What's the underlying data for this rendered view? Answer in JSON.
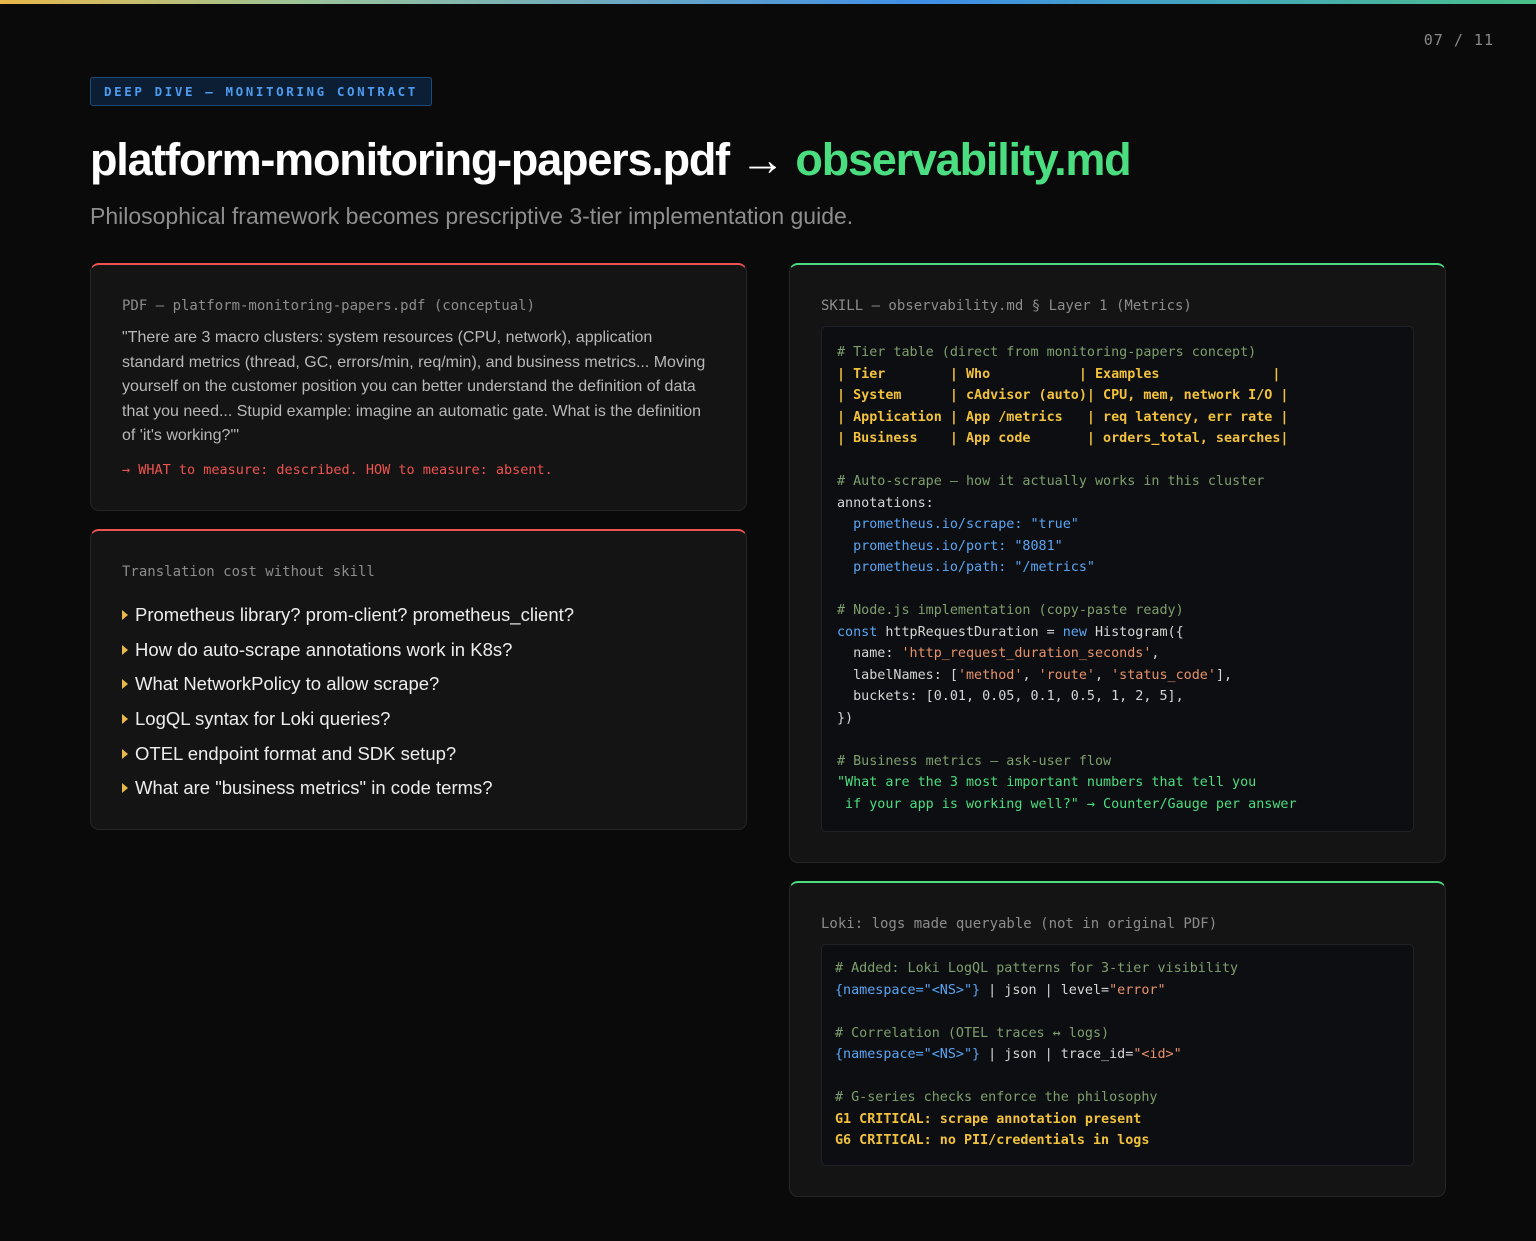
{
  "page_number": "07 / 11",
  "tag": "DEEP DIVE — MONITORING CONTRACT",
  "title": {
    "source": "platform-monitoring-papers.pdf",
    "arrow": "→",
    "target": "observability.md"
  },
  "subtitle": "Philosophical framework becomes prescriptive 3-tier implementation guide.",
  "colors": {
    "background": "#0a0a0a",
    "accent_green": "#4ade80",
    "accent_red": "#ef5350",
    "accent_blue": "#4d9cf0",
    "accent_yellow": "#f2c23d"
  },
  "pdf_card": {
    "label": "PDF — platform-monitoring-papers.pdf (conceptual)",
    "quote": "\"There are 3 macro clusters: system resources (CPU, network), application standard metrics (thread, GC, errors/min, req/min), and business metrics... Moving yourself on the customer position you can better understand the definition of data that you need... Stupid example: imagine an automatic gate. What is the definition of 'it's working?'\"",
    "verdict": "→ WHAT to measure: described. HOW to measure: absent."
  },
  "cost_card": {
    "label": "Translation cost without skill",
    "icon": "triangle-right-icon",
    "questions": [
      "Prometheus library? prom-client? prometheus_client?",
      "How do auto-scrape annotations work in K8s?",
      "What NetworkPolicy to allow scrape?",
      "LogQL syntax for Loki queries?",
      "OTEL endpoint format and SDK setup?",
      "What are \"business metrics\" in code terms?"
    ]
  },
  "skill_card": {
    "label": "SKILL — observability.md § Layer 1 (Metrics)",
    "tier_comment": "# Tier table (direct from monitoring-papers concept)",
    "tier_rows": [
      "| Tier        | Who           | Examples              |",
      "| System      | cAdvisor (auto)| CPU, mem, network I/O |",
      "| Application | App /metrics   | req latency, err rate |",
      "| Business    | App code       | orders_total, searches|"
    ],
    "scrape_comment": "# Auto-scrape — how it actually works in this cluster",
    "annotations_key": "annotations:",
    "annotations": [
      {
        "key": "prometheus.io/scrape:",
        "value": "\"true\""
      },
      {
        "key": "prometheus.io/port:",
        "value": "\"8081\""
      },
      {
        "key": "prometheus.io/path:",
        "value": "\"/metrics\""
      }
    ],
    "node_comment": "# Node.js implementation (copy-paste ready)",
    "node_code": {
      "const": "const",
      "var": "httpRequestDuration = ",
      "new": "new",
      "cls": "Histogram({",
      "name_key": "  name: ",
      "name_val": "'http_request_duration_seconds'",
      "name_end": ",",
      "label_key": "  labelNames: [",
      "label_1": "'method'",
      "label_2": "'route'",
      "label_3": "'status_code'",
      "label_end": "],",
      "buckets": "  buckets: [0.01, 0.05, 0.1, 0.5, 1, 2, 5],",
      "close": "})"
    },
    "business_comment": "# Business metrics — ask-user flow",
    "business_line1": "\"What are the 3 most important numbers that tell you",
    "business_line2": " if your app is working well?\" → Counter/Gauge per answer"
  },
  "loki_card": {
    "label": "Loki: logs made queryable (not in original PDF)",
    "comment1": "# Added: Loki LogQL patterns for 3-tier visibility",
    "query1_sel": "{namespace=\"<NS>\"}",
    "query1_mid": " | json | level=",
    "query1_val": "\"error\"",
    "comment2": "# Correlation (OTEL traces ↔ logs)",
    "query2_sel": "{namespace=\"<NS>\"}",
    "query2_mid": " | json | trace_id=",
    "query2_val": "\"<id>\"",
    "comment3": "# G-series checks enforce the philosophy",
    "check1": "G1 CRITICAL: scrape annotation present",
    "check2": "G6 CRITICAL: no PII/credentials in logs"
  }
}
